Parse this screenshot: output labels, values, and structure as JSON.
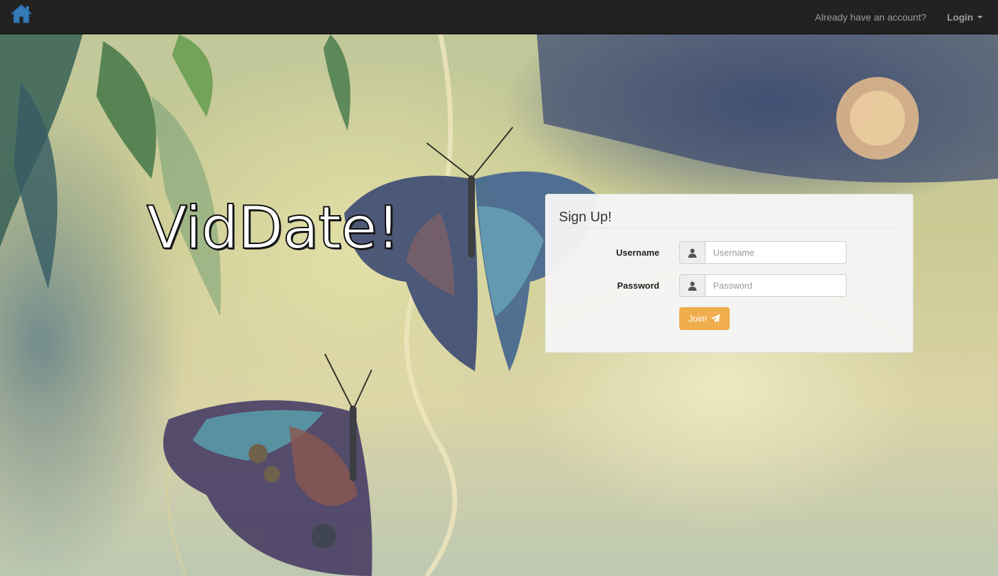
{
  "navbar": {
    "home_icon": "home-icon",
    "account_prompt": "Already have an account?",
    "login_label": "Login"
  },
  "brand": {
    "title": "VidDate!"
  },
  "signup": {
    "title": "Sign Up!",
    "username_label": "Username",
    "username_placeholder": "Username",
    "username_value": "",
    "password_label": "Password",
    "password_placeholder": "Password",
    "password_value": "",
    "join_label": "Join!",
    "join_icon": "paper-plane-icon",
    "field_icon": "user-icon"
  },
  "colors": {
    "navbar": "#222222",
    "home_icon": "#337ab7",
    "join_button": "#f0ad4e",
    "panel": "#f5f5f5"
  }
}
